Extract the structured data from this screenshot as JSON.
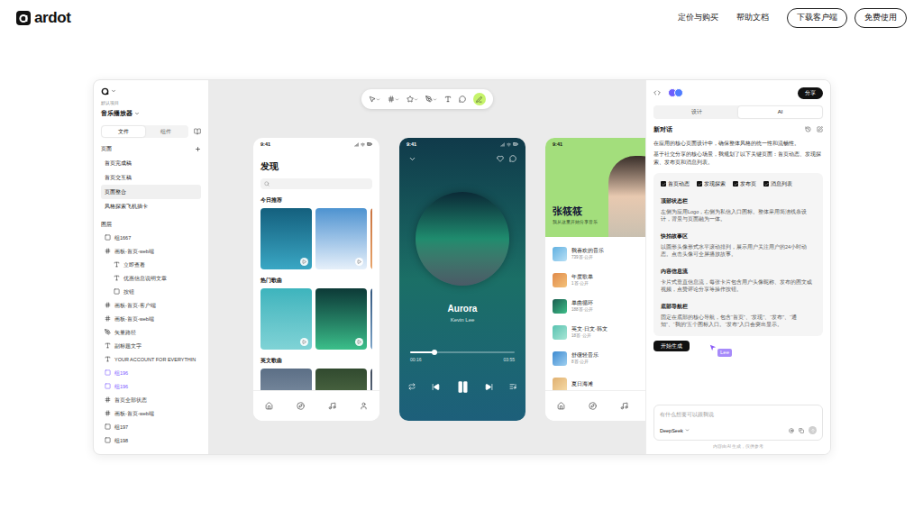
{
  "nav": {
    "brand": "ardot",
    "links": [
      "定价与购买",
      "帮助文档"
    ],
    "buttons": [
      "下载客户端",
      "免费使用"
    ]
  },
  "sidebar": {
    "project_label": "默认项目",
    "file_name": "音乐播放器",
    "tabs": [
      {
        "label": "文件",
        "selected": true
      },
      {
        "label": "组件",
        "selected": false
      }
    ],
    "pages_title": "页面",
    "pages": [
      {
        "label": "首页完成稿",
        "selected": false
      },
      {
        "label": "首页交互稿",
        "selected": false
      },
      {
        "label": "页面整合",
        "selected": true
      },
      {
        "label": "风格探索飞机插卡",
        "selected": false
      }
    ],
    "layers_title": "图层",
    "layers": [
      {
        "label": "组1667",
        "kind": "group",
        "nested": false,
        "selected": false
      },
      {
        "label": "画板-首页-web端",
        "kind": "frame",
        "nested": false,
        "selected": false
      },
      {
        "label": "立即查看",
        "kind": "text",
        "nested": true,
        "selected": false
      },
      {
        "label": "优惠信息说明文章",
        "kind": "text",
        "nested": true,
        "selected": false
      },
      {
        "label": "按钮",
        "kind": "group",
        "nested": true,
        "selected": false
      },
      {
        "label": "画板-首页-客户端",
        "kind": "frame",
        "nested": false,
        "selected": false
      },
      {
        "label": "画板-首页-web端",
        "kind": "frame",
        "nested": false,
        "selected": false
      },
      {
        "label": "矢量路径",
        "kind": "vector",
        "nested": false,
        "selected": false
      },
      {
        "label": "副标题文字",
        "kind": "text",
        "nested": false,
        "selected": false
      },
      {
        "label": "YOUR ACCOUNT FOR EVERYTHIN",
        "kind": "text",
        "nested": false,
        "selected": false
      },
      {
        "label": "组196",
        "kind": "group",
        "nested": false,
        "selected": true
      },
      {
        "label": "组196",
        "kind": "group",
        "nested": false,
        "selected": true
      },
      {
        "label": "首页全部状态",
        "kind": "frame",
        "nested": false,
        "selected": false
      },
      {
        "label": "画板-首页-web端",
        "kind": "frame",
        "nested": false,
        "selected": false
      },
      {
        "label": "组197",
        "kind": "group",
        "nested": false,
        "selected": false
      },
      {
        "label": "组198",
        "kind": "group",
        "nested": false,
        "selected": false
      }
    ]
  },
  "discover_screen": {
    "time": "9:41",
    "title": "发现",
    "sections": [
      "今日推荐",
      "热门歌曲",
      "英文歌曲"
    ]
  },
  "player_screen": {
    "time": "9:41",
    "song": "Aurora",
    "artist": "Kevin Lee",
    "elapsed": "00:16",
    "duration": "03:55",
    "level": 0.23,
    "playing": true,
    "liked": false
  },
  "profile_screen": {
    "time": "9:41",
    "name": "张筱筱",
    "bio": "我从这里开始分享音乐",
    "playlists": [
      {
        "title": "我喜欢的音乐",
        "meta": "739首·公开"
      },
      {
        "title": "年度歌单",
        "meta": "1首·公开"
      },
      {
        "title": "单曲循环",
        "meta": "188首·公开"
      },
      {
        "title": "英文·日文·韩文",
        "meta": "18首·公开"
      },
      {
        "title": "舒缓轻音乐",
        "meta": "8首·公开"
      },
      {
        "title": "夏日海滩"
      }
    ]
  },
  "ai_panel": {
    "share": "分享",
    "tabs": [
      {
        "label": "设计",
        "selected": false
      },
      {
        "label": "AI",
        "selected": true
      }
    ],
    "conversation_title": "新对话",
    "intro": [
      "在应用的核心页面设计中，确保整体风格的统一性和流畅性。",
      "基于社交分享的核心场景，我规划了以下关键页面：首页动态、发现探索、发布页和消息列表。"
    ],
    "options": [
      {
        "label": "首页动态",
        "checked": true
      },
      {
        "label": "发现探索",
        "checked": true
      },
      {
        "label": "发布页",
        "checked": true
      },
      {
        "label": "消息列表",
        "checked": true
      }
    ],
    "sections": [
      {
        "title": "顶部状态栏",
        "text": "左侧为应用Logo，右侧为私信入口图标。整体采用简洁线条设计，背景与页面融为一体。"
      },
      {
        "title": "快拍故事区",
        "text": "以圆形头像形式水平滚动排列，展示用户关注用户的24小时动态。点击头像可全屏播放故事。"
      },
      {
        "title": "内容信息流",
        "text": "卡片式垂直信息流，每张卡片包含用户头像昵称、发布的图文或视频，点赞评论分享等操作按钮。"
      },
      {
        "title": "底部导航栏",
        "text": "固定在底部的核心导航，包含“首页”、“发现”、“发布”、“通知”、“我的”五个图标入口。“发布”入口会突出显示。"
      }
    ],
    "generate_button": "开始生成",
    "cursor_label": "Lee",
    "input_placeholder": "有什么想要可以跟我说",
    "model": "DeepSeek",
    "footer": "内容由 AI 生成，仅供参考"
  }
}
